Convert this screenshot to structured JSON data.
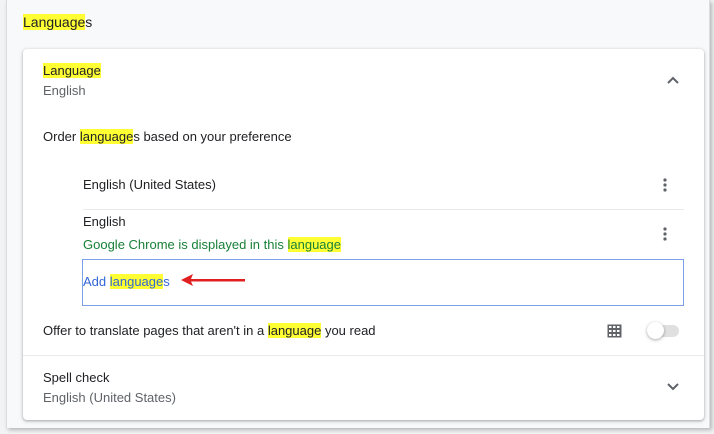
{
  "section": {
    "title_hl": "Language",
    "title_rest": "s"
  },
  "language_row": {
    "title": "Language",
    "value": "English"
  },
  "order_text": {
    "before": "Order ",
    "hl": "language",
    "after": "s based on your preference"
  },
  "languages": [
    {
      "name": "English (United States)"
    },
    {
      "name": "English",
      "note_before": "Google Chrome is displayed in this ",
      "note_hl": "language"
    }
  ],
  "add_languages": {
    "before": "Add ",
    "hl": "language",
    "after": "s"
  },
  "offer_translate": {
    "before": "Offer to translate pages that aren't in a ",
    "hl": "language",
    "after": " you read",
    "enabled": false
  },
  "spell_check": {
    "title": "Spell check",
    "value": "English (United States)"
  },
  "colors": {
    "highlight": "#ffff33",
    "link": "#3367d6",
    "note_green": "#188038",
    "annotation_arrow": "#e02020"
  },
  "icons": {
    "expand_less": "chevron-up-icon",
    "expand_more": "chevron-down-icon",
    "more_actions": "three-dots-vertical-icon",
    "translate": "translate-grid-icon",
    "annotation": "red-arrow-icon"
  }
}
